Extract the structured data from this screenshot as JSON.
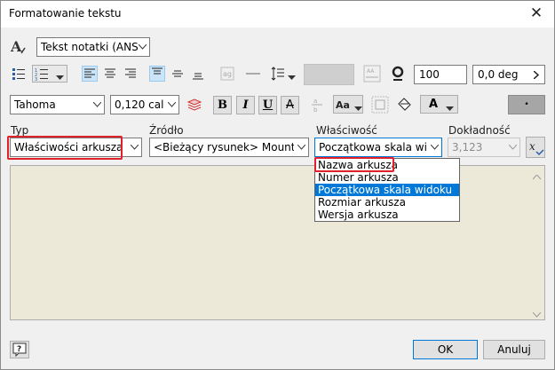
{
  "window": {
    "title": "Formatowanie tekstu"
  },
  "toolbar": {
    "text_style": "Tekst notatki (ANS",
    "stretch_value": "100",
    "rotation_value": "0,0 deg"
  },
  "format": {
    "font": "Tahoma",
    "font_size": "0,120 cal",
    "bold": "B",
    "italic": "I",
    "underline": "U",
    "strike": "A",
    "color_letter": "A"
  },
  "fields": {
    "type_label": "Typ",
    "type_value": "Właściwości arkusza",
    "source_label": "Źródło",
    "source_value": "<Bieżący rysunek> Mounting",
    "property_label": "Właściwość",
    "property_value": "Początkowa skala wido",
    "precision_label": "Dokładność",
    "precision_value": "3,123"
  },
  "property_options": [
    "Nazwa arkusza",
    "Numer arkusza",
    "Początkowa skala widoku",
    "Rozmiar arkusza",
    "Wersja arkusza"
  ],
  "property_selected_index": 2,
  "buttons": {
    "ok": "OK",
    "cancel": "Anuluj"
  },
  "colors": {
    "selection": "#0078d7",
    "highlight_box": "#e0202a",
    "text_area": "#ece9d8"
  }
}
